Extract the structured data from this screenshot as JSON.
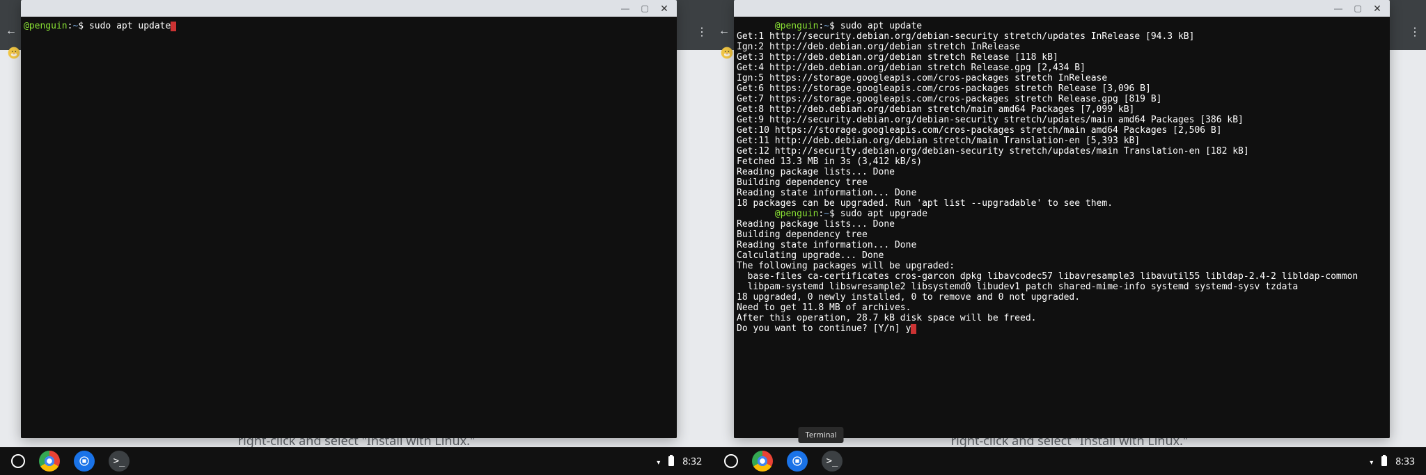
{
  "left": {
    "hint": "right-click and select \"Install with Linux.\"",
    "tooltip": null,
    "prompt": {
      "user_prefix": "@",
      "host": "penguin",
      "path": "~",
      "symbol": "$"
    },
    "command": "sudo apt update",
    "output_lines": [],
    "status": {
      "time": "8:32"
    }
  },
  "right": {
    "hint": "right-click and select \"Install with Linux.\"",
    "tooltip": "Terminal",
    "prompt1": {
      "user_prefix": "@",
      "host": "penguin",
      "path": "~",
      "symbol": "$",
      "command": "sudo apt update"
    },
    "output1": [
      "Get:1 http://security.debian.org/debian-security stretch/updates InRelease [94.3 kB]",
      "Ign:2 http://deb.debian.org/debian stretch InRelease",
      "Get:3 http://deb.debian.org/debian stretch Release [118 kB]",
      "Get:4 http://deb.debian.org/debian stretch Release.gpg [2,434 B]",
      "Ign:5 https://storage.googleapis.com/cros-packages stretch InRelease",
      "Get:6 https://storage.googleapis.com/cros-packages stretch Release [3,096 B]",
      "Get:7 https://storage.googleapis.com/cros-packages stretch Release.gpg [819 B]",
      "Get:8 http://deb.debian.org/debian stretch/main amd64 Packages [7,099 kB]",
      "Get:9 http://security.debian.org/debian-security stretch/updates/main amd64 Packages [386 kB]",
      "Get:10 https://storage.googleapis.com/cros-packages stretch/main amd64 Packages [2,506 B]",
      "Get:11 http://deb.debian.org/debian stretch/main Translation-en [5,393 kB]",
      "Get:12 http://security.debian.org/debian-security stretch/updates/main Translation-en [182 kB]",
      "Fetched 13.3 MB in 3s (3,412 kB/s)",
      "Reading package lists... Done",
      "Building dependency tree",
      "Reading state information... Done",
      "18 packages can be upgraded. Run 'apt list --upgradable' to see them."
    ],
    "prompt2": {
      "user_prefix": "@",
      "host": "penguin",
      "path": "~",
      "symbol": "$",
      "command": "sudo apt upgrade"
    },
    "output2": [
      "Reading package lists... Done",
      "Building dependency tree",
      "Reading state information... Done",
      "Calculating upgrade... Done",
      "The following packages will be upgraded:",
      "  base-files ca-certificates cros-garcon dpkg libavcodec57 libavresample3 libavutil55 libldap-2.4-2 libldap-common",
      "  libpam-systemd libswresample2 libsystemd0 libudev1 patch shared-mime-info systemd systemd-sysv tzdata",
      "18 upgraded, 0 newly installed, 0 to remove and 0 not upgraded.",
      "Need to get 11.8 MB of archives.",
      "After this operation, 28.7 kB disk space will be freed.",
      "Do you want to continue? [Y/n] y"
    ],
    "status": {
      "time": "8:33"
    }
  }
}
